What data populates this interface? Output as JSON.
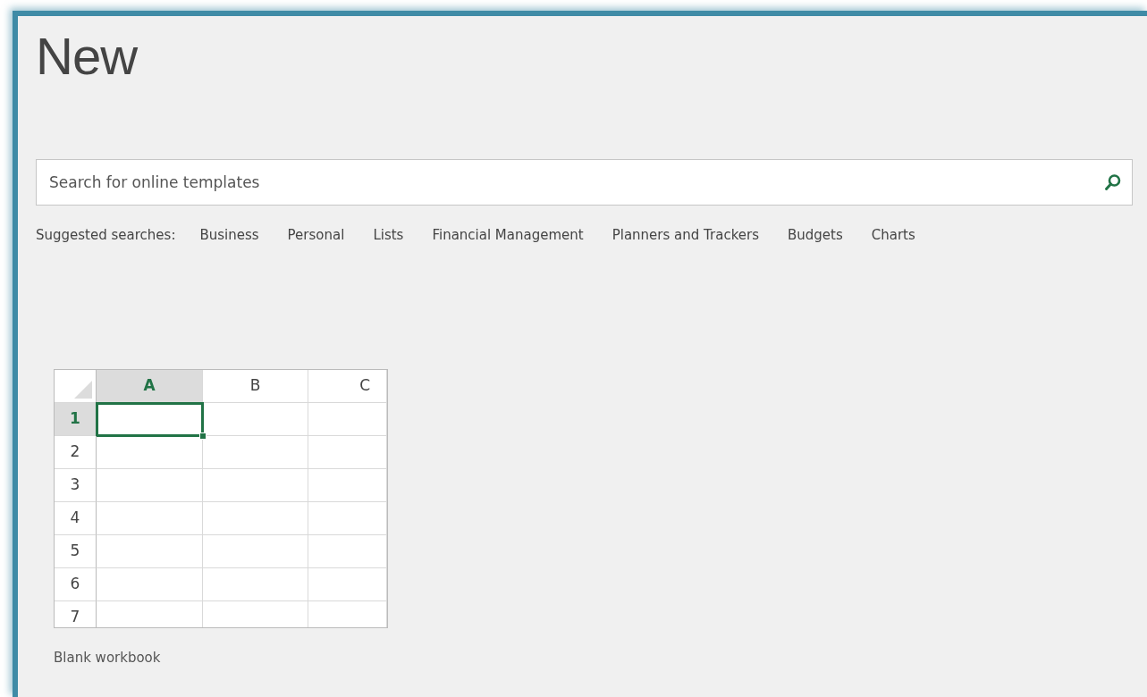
{
  "title": "New",
  "search": {
    "placeholder": "Search for online templates"
  },
  "suggested": {
    "label": "Suggested searches:",
    "items": [
      "Business",
      "Personal",
      "Lists",
      "Financial Management",
      "Planners and Trackers",
      "Budgets",
      "Charts"
    ]
  },
  "template": {
    "columns": [
      {
        "label": "A",
        "selected": true
      },
      {
        "label": "B",
        "selected": false
      },
      {
        "label": "C",
        "selected": false
      }
    ],
    "rows": [
      {
        "label": "1",
        "selected": true
      },
      {
        "label": "2",
        "selected": false
      },
      {
        "label": "3",
        "selected": false
      },
      {
        "label": "4",
        "selected": false
      },
      {
        "label": "5",
        "selected": false
      },
      {
        "label": "6",
        "selected": false
      },
      {
        "label": "7",
        "selected": false
      }
    ],
    "caption": "Blank workbook"
  }
}
